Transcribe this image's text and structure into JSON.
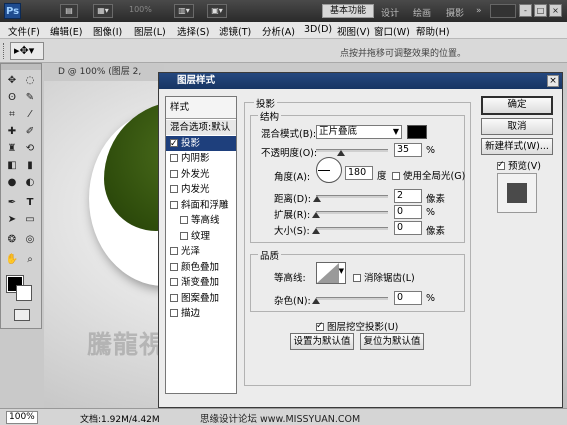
{
  "app": {
    "logo": "Ps",
    "zoom_combo": "100%",
    "workspace_button": "基本功能",
    "workspace_tabs": [
      "设计",
      "绘画",
      "摄影"
    ],
    "window_buttons": [
      "-",
      "□",
      "×"
    ]
  },
  "menu": [
    "文件(F)",
    "编辑(E)",
    "图像(I)",
    "图层(L)",
    "选择(S)",
    "滤镜(T)",
    "分析(A)",
    "3D(D)",
    "视图(V)",
    "窗口(W)",
    "帮助(H)"
  ],
  "options_bar": {
    "hint": "点按并拖移可调整效果的位置。"
  },
  "document": {
    "tab_title": "D @ 100% (图层 2, RGB/8)",
    "zoom": "100%",
    "doc_info": "文档:1.92M/4.42M",
    "watermark": "騰龍視覺WWW.TLVI.NET",
    "credit": "思缘设计论坛 www.MISSYUAN.COM"
  },
  "dialog": {
    "title": "图层样式",
    "close": "×",
    "list_header": "样式",
    "styles": [
      {
        "label": "混合选项:默认",
        "checkbox": false,
        "indent": false,
        "selected": false,
        "blend": true
      },
      {
        "label": "投影",
        "checkbox": true,
        "checked": true,
        "indent": false,
        "selected": true
      },
      {
        "label": "内阴影",
        "checkbox": true,
        "checked": false,
        "indent": false
      },
      {
        "label": "外发光",
        "checkbox": true,
        "checked": false,
        "indent": false
      },
      {
        "label": "内发光",
        "checkbox": true,
        "checked": false,
        "indent": false
      },
      {
        "label": "斜面和浮雕",
        "checkbox": true,
        "checked": false,
        "indent": false
      },
      {
        "label": "等高线",
        "checkbox": true,
        "checked": false,
        "indent": true
      },
      {
        "label": "纹理",
        "checkbox": true,
        "checked": false,
        "indent": true
      },
      {
        "label": "光泽",
        "checkbox": true,
        "checked": false,
        "indent": false
      },
      {
        "label": "颜色叠加",
        "checkbox": true,
        "checked": false,
        "indent": false
      },
      {
        "label": "渐变叠加",
        "checkbox": true,
        "checked": false,
        "indent": false
      },
      {
        "label": "图案叠加",
        "checkbox": true,
        "checked": false,
        "indent": false
      },
      {
        "label": "描边",
        "checkbox": true,
        "checked": false,
        "indent": false
      }
    ],
    "drop_shadow": {
      "section_title": "投影",
      "structure_title": "结构",
      "blend_mode_label": "混合模式(B):",
      "blend_mode_value": "正片叠底",
      "shadow_color": "#000000",
      "opacity_label": "不透明度(O):",
      "opacity_value": "35",
      "opacity_level": 0.35,
      "percent": "%",
      "angle_label": "角度(A):",
      "angle_value": "180",
      "angle_unit": "度",
      "global_light_label": "使用全局光(G)",
      "distance_label": "距离(D):",
      "distance_value": "2",
      "distance_level": 0.02,
      "pixels": "像素",
      "spread_label": "扩展(R):",
      "spread_value": "0",
      "spread_level": 0,
      "size_label": "大小(S):",
      "size_value": "0",
      "size_level": 0,
      "quality_title": "品质",
      "contour_label": "等高线:",
      "antialias_label": "消除锯齿(L)",
      "noise_label": "杂色(N):",
      "noise_value": "0",
      "noise_level": 0,
      "knockout_label": "图层挖空投影(U)",
      "make_default": "设置为默认值",
      "reset_default": "复位为默认值"
    },
    "buttons": {
      "ok": "确定",
      "cancel": "取消",
      "new_style": "新建样式(W)...",
      "preview": "预览(V)"
    }
  }
}
